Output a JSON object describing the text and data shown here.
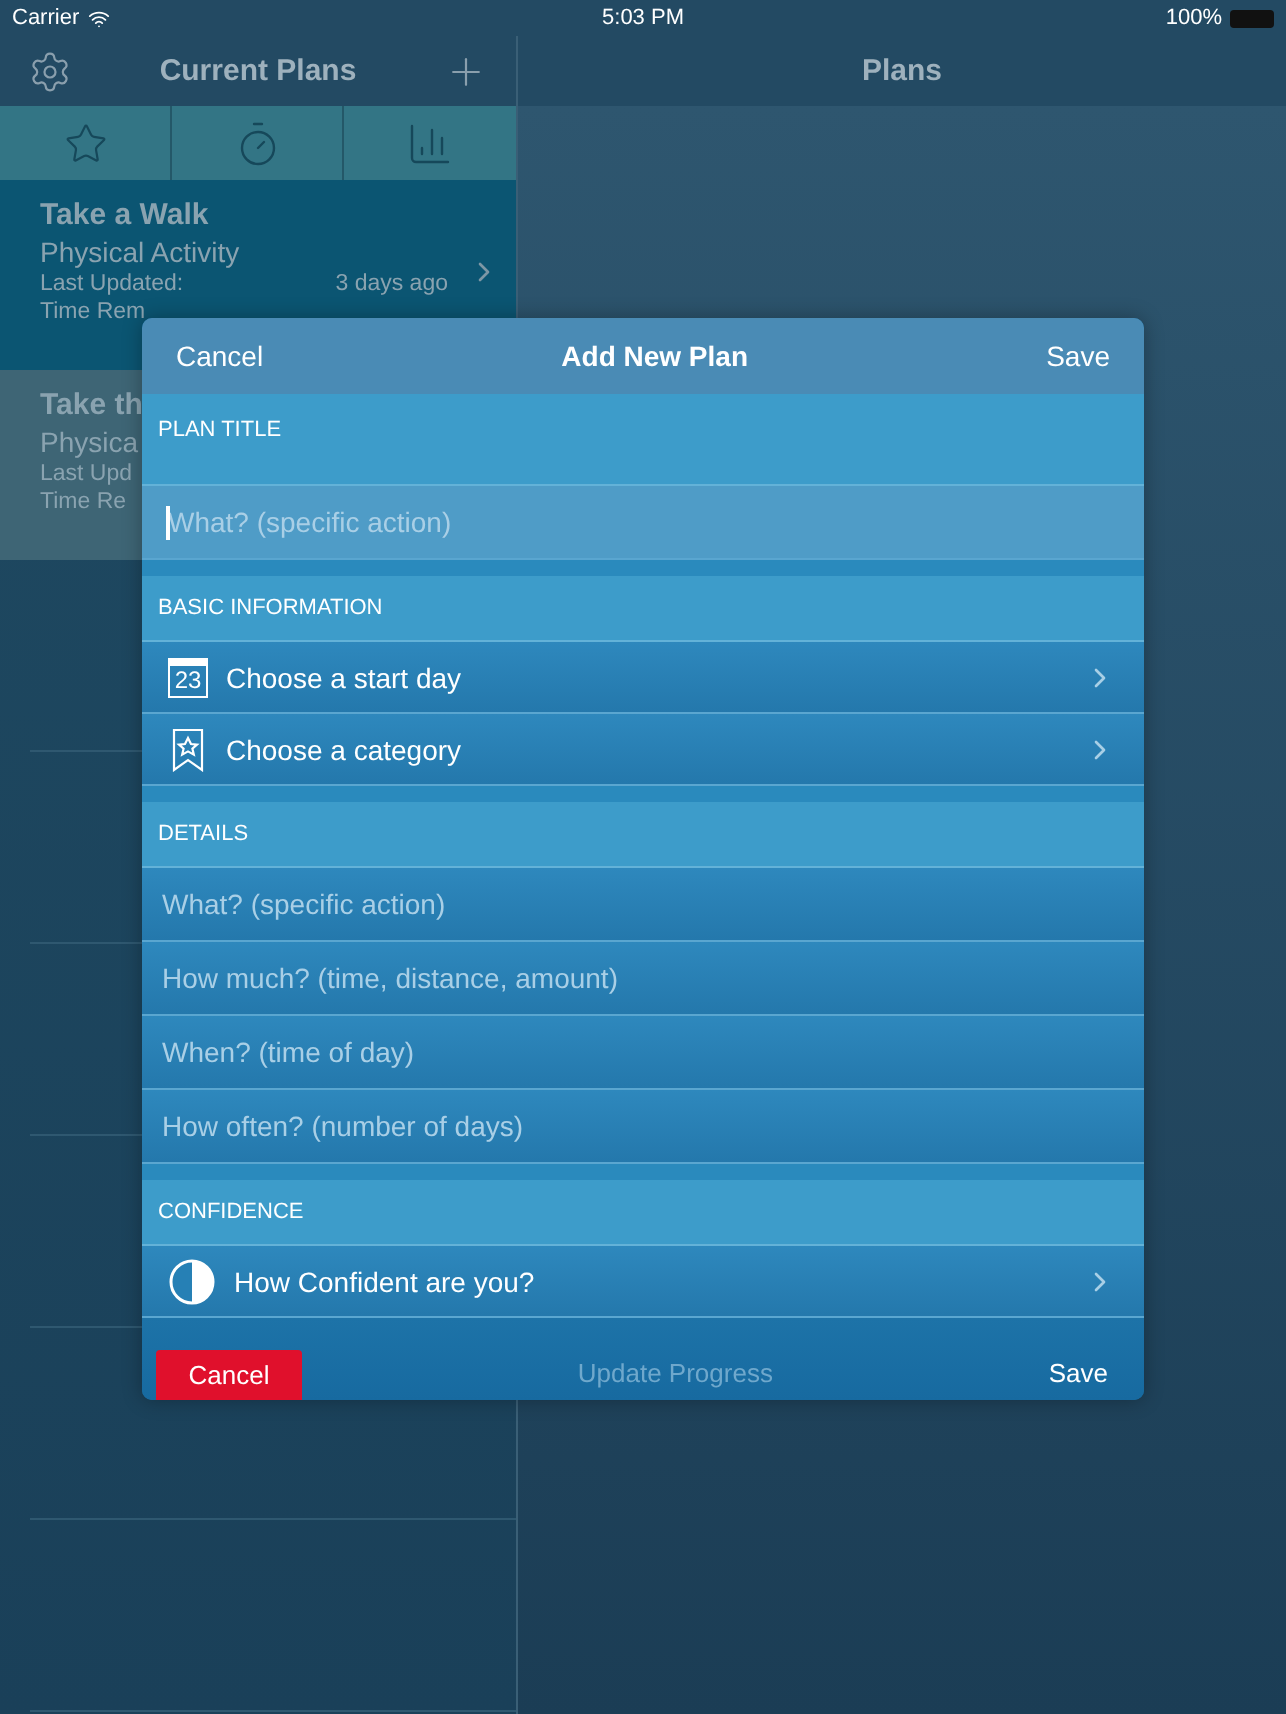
{
  "status_bar": {
    "carrier": "Carrier",
    "time": "5:03 PM",
    "battery": "100%"
  },
  "sidebar": {
    "title": "Current Plans",
    "plans": [
      {
        "title": "Take a Walk",
        "category": "Physical Activity",
        "updated_label": "Last Updated:",
        "updated_value": "3 days ago",
        "remaining_label": "Time Rem",
        "selected": true
      },
      {
        "title": "Take th",
        "category": "Physica",
        "updated_label": "Last Upd",
        "remaining_label": "Time Re",
        "selected": false
      }
    ]
  },
  "detail": {
    "title": "Plans"
  },
  "modal": {
    "cancel": "Cancel",
    "title": "Add New Plan",
    "save": "Save",
    "sections": [
      {
        "header": "PLAN TITLE",
        "kind": "title",
        "rows": [
          {
            "kind": "field",
            "placeholder": "What? (specific action)",
            "focused": true
          }
        ]
      },
      {
        "header": "BASIC INFORMATION",
        "kind": "list",
        "rows": [
          {
            "kind": "date",
            "label": "Choose a start day",
            "day": "23"
          },
          {
            "kind": "category",
            "label": "Choose a category"
          }
        ]
      },
      {
        "header": "DETAILS",
        "kind": "list",
        "rows": [
          {
            "kind": "field",
            "placeholder": "What? (specific action)",
            "focused": false
          },
          {
            "kind": "field",
            "placeholder": "How much? (time, distance, amount)",
            "focused": false
          },
          {
            "kind": "field",
            "placeholder": "When? (time of day)",
            "focused": false
          },
          {
            "kind": "field",
            "placeholder": "How often? (number of days)",
            "focused": false
          }
        ]
      },
      {
        "header": "CONFIDENCE",
        "kind": "list",
        "rows": [
          {
            "kind": "confidence",
            "label": "How Confident are you?"
          }
        ]
      }
    ],
    "footer": {
      "cancel": "Cancel",
      "middle": "Update Progress",
      "middle_disabled": true,
      "save": "Save"
    }
  }
}
